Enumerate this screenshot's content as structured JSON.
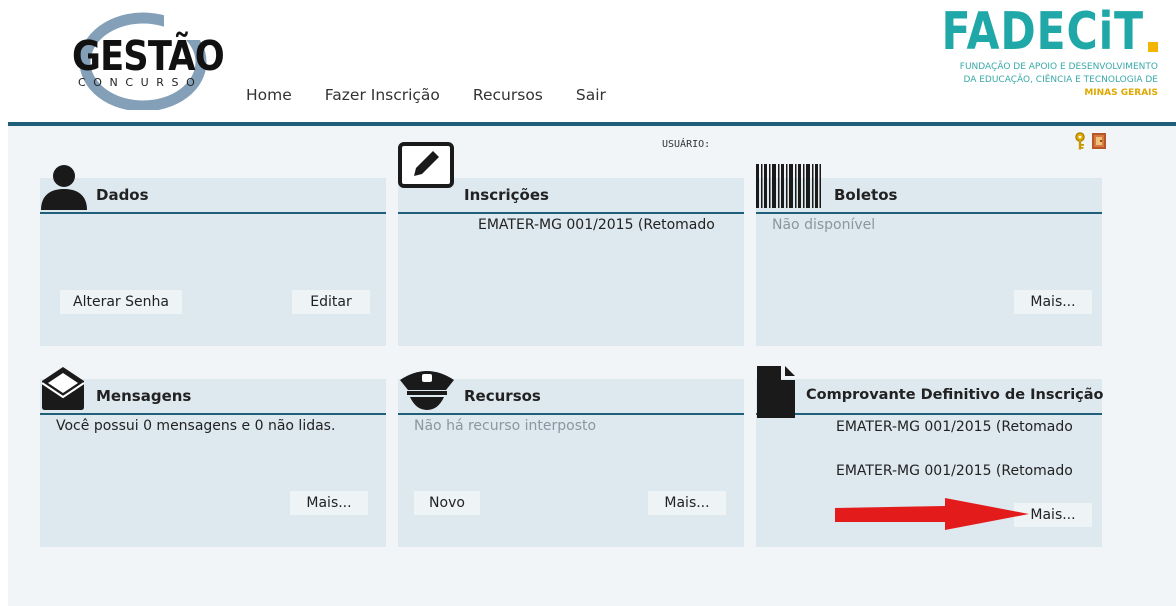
{
  "header": {
    "logo_gestao": {
      "word": "GESTÃO",
      "sub": "CONCURSO"
    },
    "nav": [
      "Home",
      "Fazer Inscrição",
      "Recursos",
      "Sair"
    ],
    "logo_fadecit": {
      "brand": "FADECiT",
      "line1": "FUNDAÇÃO DE APOIO E DESENVOLVIMENTO",
      "line2": "DA EDUCAÇÃO, CIÊNCIA E TECNOLOGIA DE",
      "line3": "MINAS GERAIS"
    }
  },
  "user_label": "USUÁRIO:",
  "panels": {
    "dados": {
      "title": "Dados",
      "alterar_senha": "Alterar Senha",
      "editar": "Editar"
    },
    "inscricoes": {
      "title": "Inscrições",
      "item": "EMATER-MG 001/2015 (Retomado"
    },
    "boletos": {
      "title": "Boletos",
      "status": "Não disponível",
      "mais": "Mais..."
    },
    "mensagens": {
      "title": "Mensagens",
      "text": "Você possui 0 mensagens e 0 não lidas.",
      "mais": "Mais..."
    },
    "recursos": {
      "title": "Recursos",
      "status": "Não há recurso interposto",
      "novo": "Novo",
      "mais": "Mais..."
    },
    "comprovante": {
      "title": "Comprovante Definitivo de Inscrição",
      "items": [
        "EMATER-MG 001/2015 (Retomado",
        "EMATER-MG 001/2015 (Retomado"
      ],
      "mais": "Mais..."
    }
  },
  "colors": {
    "accent_rule": "#1f5f7a",
    "panel_bg": "#dde8ef",
    "page_bg": "#f1f5f8",
    "fadecit_teal": "#1fa8a7",
    "annotation_arrow": "#e31b1b"
  },
  "icons": [
    "person-icon",
    "pencil-icon",
    "barcode-icon",
    "envelope-icon",
    "officer-cap-icon",
    "document-icon",
    "key-icon",
    "exit-door-icon",
    "annotation-arrow"
  ]
}
